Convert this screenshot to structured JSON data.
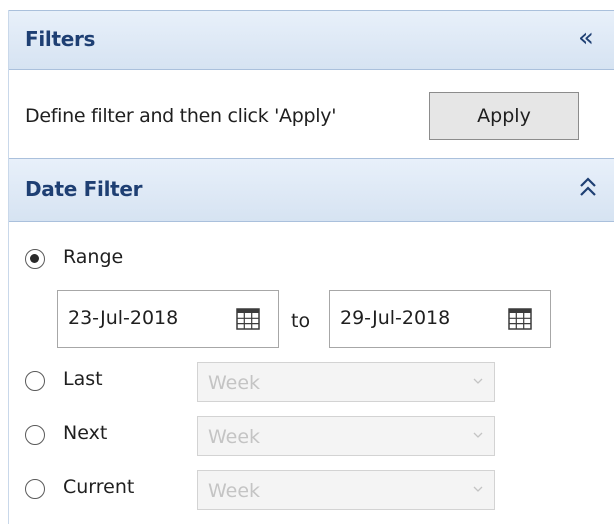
{
  "filters_panel": {
    "title": "Filters",
    "collapse_glyph": "«",
    "collapse_icon": "double-chevron-left-icon",
    "instruction": "Define filter and then click 'Apply'",
    "apply_label": "Apply"
  },
  "date_filter": {
    "title": "Date Filter",
    "expand_icon": "double-chevron-up-icon",
    "selected_option": "Range",
    "range": {
      "label": "Range",
      "from_value": "23-Jul-2018",
      "to_label": "to",
      "to_value": "29-Jul-2018",
      "calendar_icon": "calendar-icon"
    },
    "options": [
      {
        "label": "Last",
        "selected": "Week",
        "disabled": true
      },
      {
        "label": "Next",
        "selected": "Week",
        "disabled": true
      },
      {
        "label": "Current",
        "selected": "Week",
        "disabled": true
      }
    ]
  },
  "colors": {
    "header_text": "#1e3f73",
    "header_bg_top": "#e8f0fa",
    "header_bg_bottom": "#d6e3f2",
    "header_border": "#aac0dc",
    "button_bg": "#e6e6e6",
    "disabled_text": "#c4c4c4"
  }
}
